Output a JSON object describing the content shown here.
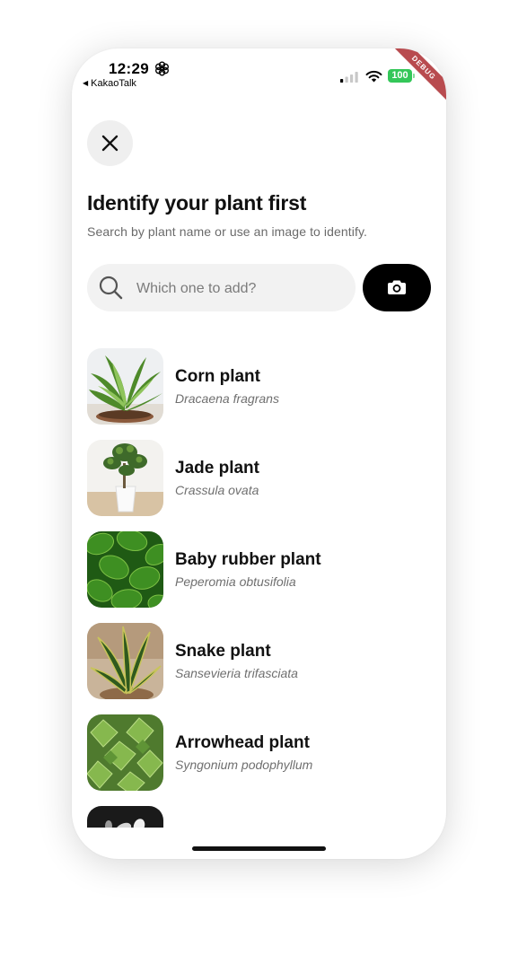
{
  "status_bar": {
    "time": "12:29",
    "back_app": "KakaoTalk",
    "battery": "100",
    "debug_label": "DEBUG"
  },
  "header": {
    "close_icon": "close-icon",
    "title": "Identify your plant first",
    "subtitle": "Search by plant name or use an image to identify."
  },
  "search": {
    "placeholder": "Which one to add?",
    "value": "",
    "search_icon": "search-icon",
    "camera_icon": "camera-icon"
  },
  "plants": [
    {
      "name": "Corn plant",
      "scientific": "Dracaena fragrans"
    },
    {
      "name": "Jade plant",
      "scientific": "Crassula ovata"
    },
    {
      "name": "Baby rubber plant",
      "scientific": "Peperomia obtusifolia"
    },
    {
      "name": "Snake plant",
      "scientific": "Sansevieria trifasciata"
    },
    {
      "name": "Arrowhead plant",
      "scientific": "Syngonium podophyllum"
    },
    {
      "name": "",
      "scientific": ""
    }
  ],
  "colors": {
    "accent": "#000000",
    "battery": "#34c759",
    "debug_ribbon": "#b84b4f",
    "search_bg": "#f2f2f2"
  }
}
